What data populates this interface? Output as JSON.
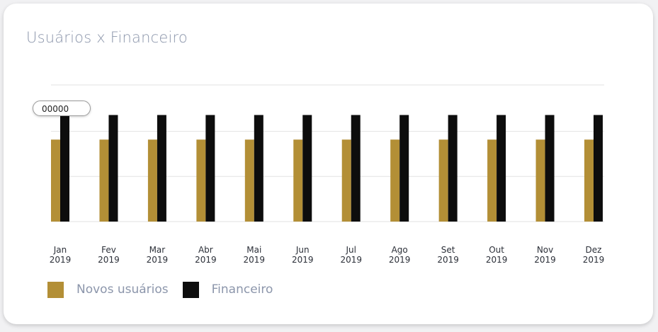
{
  "card": {
    "title": "Usuários x Financeiro"
  },
  "tooltip": {
    "value": "00000"
  },
  "legend": [
    {
      "label": "Novos usuários",
      "color": "#b38f36"
    },
    {
      "label": "Financeiro",
      "color": "#0d0d0d"
    }
  ],
  "chart_data": {
    "type": "bar",
    "categories": [
      [
        "Jan",
        "2019"
      ],
      [
        "Fev",
        "2019"
      ],
      [
        "Mar",
        "2019"
      ],
      [
        "Abr",
        "2019"
      ],
      [
        "Mai",
        "2019"
      ],
      [
        "Jun",
        "2019"
      ],
      [
        "Jul",
        "2019"
      ],
      [
        "Ago",
        "2019"
      ],
      [
        "Set",
        "2019"
      ],
      [
        "Out",
        "2019"
      ],
      [
        "Nov",
        "2019"
      ],
      [
        "Dez",
        "2019"
      ]
    ],
    "series": [
      {
        "name": "Novos usuários",
        "color": "#b38f36",
        "values": [
          60,
          60,
          60,
          60,
          60,
          60,
          60,
          60,
          60,
          60,
          60,
          60
        ]
      },
      {
        "name": "Financeiro",
        "color": "#0d0d0d",
        "values": [
          78,
          78,
          78,
          78,
          78,
          78,
          78,
          78,
          78,
          78,
          78,
          78
        ]
      }
    ],
    "ylim": [
      0,
      100
    ],
    "gridlines": [
      0,
      33,
      66,
      100
    ],
    "grid": true,
    "legend_position": "bottom-left"
  }
}
